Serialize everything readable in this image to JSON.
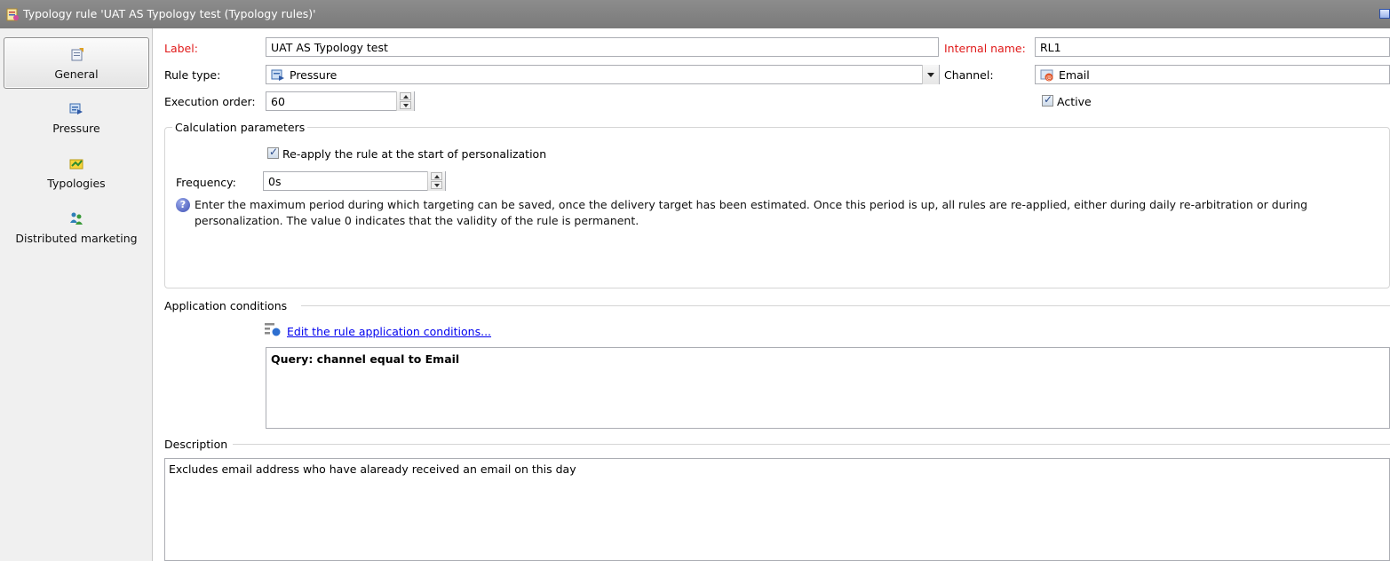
{
  "window": {
    "title": "Typology rule 'UAT AS Typology test (Typology rules)'",
    "title_icon": "typology-rule-icon",
    "maximize_icon": "window-button-icon"
  },
  "sidebar": {
    "items": [
      {
        "label": "General",
        "icon": "general-properties-icon",
        "selected": true
      },
      {
        "label": "Pressure",
        "icon": "pressure-icon",
        "selected": false
      },
      {
        "label": "Typologies",
        "icon": "typologies-icon",
        "selected": false
      },
      {
        "label": "Distributed marketing",
        "icon": "distributed-marketing-icon",
        "selected": false
      }
    ]
  },
  "form": {
    "label_label": "Label:",
    "label_value": "UAT AS Typology test",
    "internal_name_label": "Internal name:",
    "internal_name_value": "RL1",
    "rule_type_label": "Rule type:",
    "rule_type_value": "Pressure",
    "channel_label": "Channel:",
    "channel_value": "Email",
    "execution_order_label": "Execution order:",
    "execution_order_value": "60",
    "active_label": "Active",
    "active_checked": true
  },
  "calculation": {
    "title": "Calculation parameters",
    "reapply_label": "Re-apply the rule at the start of personalization",
    "reapply_checked": true,
    "frequency_label": "Frequency:",
    "frequency_value": "0s",
    "help_line1": "Enter the maximum period during which targeting can be saved, once the delivery target has been estimated. Once this period is up, all rules are re-applied, either during daily re-arbitration or during",
    "help_line2": "personalization. The value 0 indicates that the validity of the rule is permanent."
  },
  "application": {
    "title": "Application conditions",
    "edit_link": "Edit the rule application conditions...",
    "query": "Query: channel equal to Email"
  },
  "description": {
    "title": "Description",
    "text": "Excludes email address who have alaready received an email on this day"
  },
  "colors": {
    "titlebar": "#838383",
    "required_label": "#e01919",
    "link": "#0000ee",
    "sidebar_bg": "#f0f0f0"
  }
}
